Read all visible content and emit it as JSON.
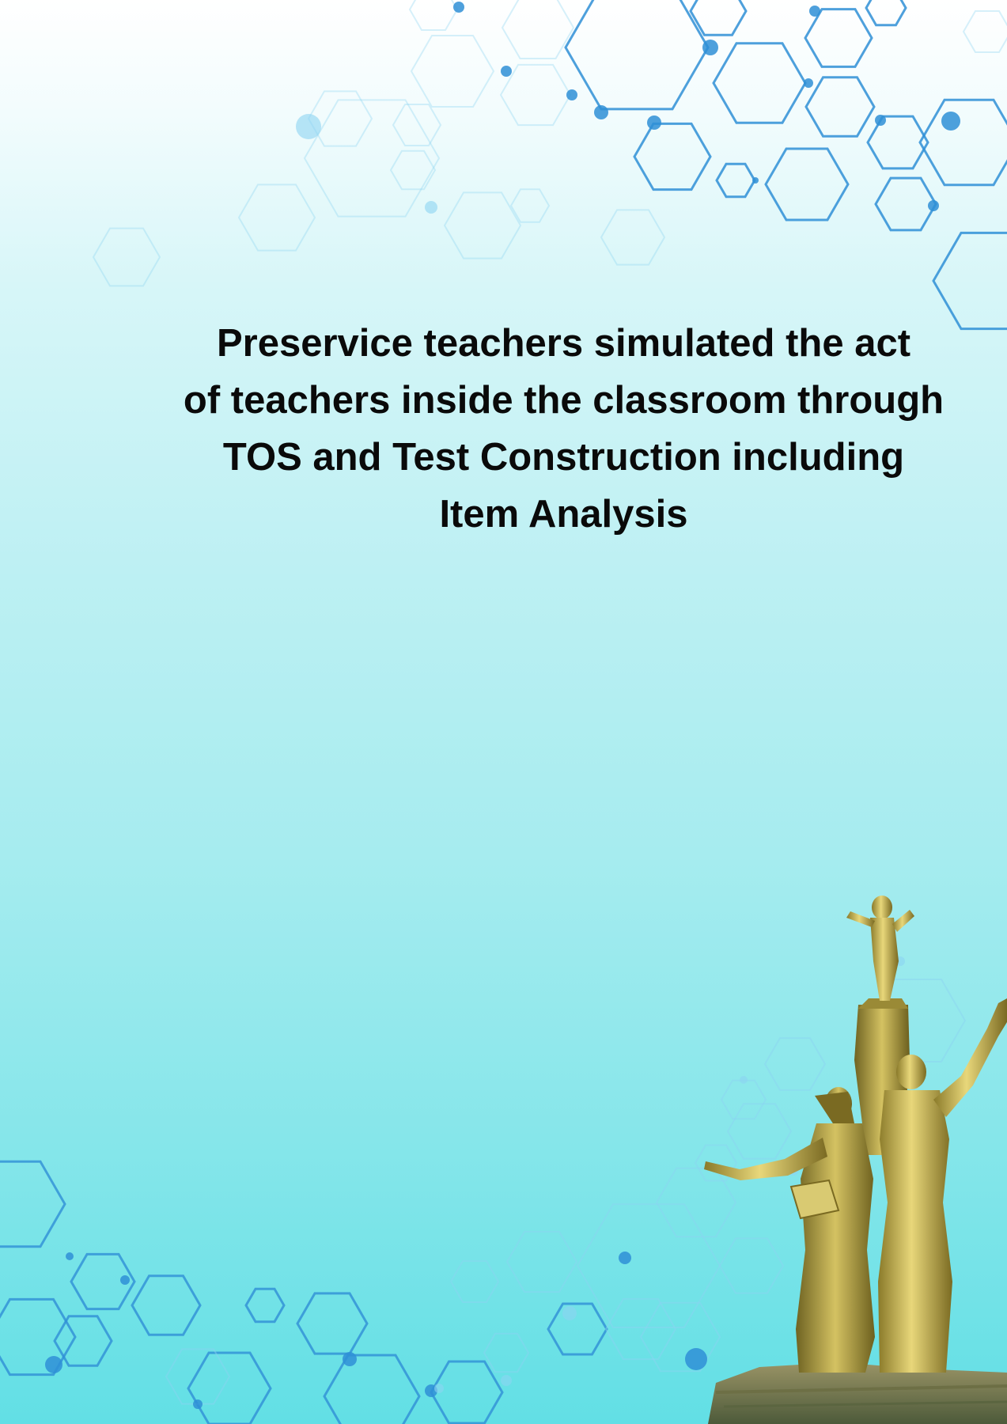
{
  "document": {
    "headline_lines": [
      "Preservice teachers simulated the act",
      "of teachers inside the classroom through",
      "TOS and Test Construction including",
      "Item Analysis"
    ]
  },
  "decorations": {
    "top_pattern": "hexagon-network",
    "bottom_pattern": "hexagon-network",
    "statue": "golden-monument-statue"
  },
  "colors": {
    "background_top": "#ffffff",
    "background_bottom": "#62dfe5",
    "hex_primary": "#2f8fd6",
    "hex_light": "#8cd3f2",
    "statue_gold": "#b8a24a",
    "text": "#0a0a0a"
  }
}
